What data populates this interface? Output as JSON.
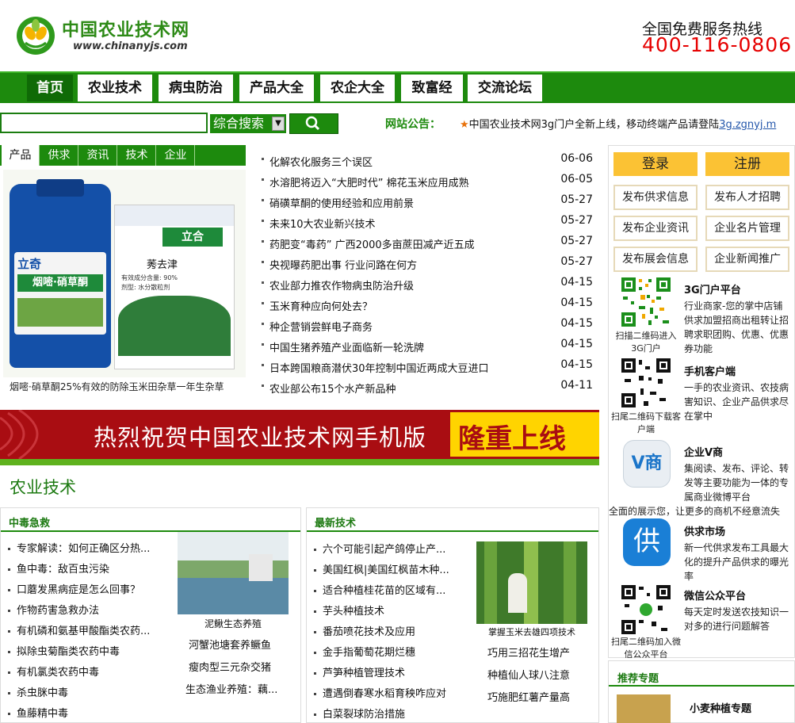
{
  "header": {
    "site_name": "中国农业技术网",
    "domain": "www.chinanyjs.com",
    "hotline_label": "全国免费服务热线",
    "hotline_number": "400-116-0806"
  },
  "nav": [
    "首页",
    "农业技术",
    "病虫防治",
    "产品大全",
    "农企大全",
    "致富经",
    "交流论坛"
  ],
  "search": {
    "placeholder": "",
    "select_value": "综合搜索"
  },
  "notice": {
    "label": "网站公告：",
    "text": "中国农业技术网3g门户全新上线，移动终端产品请登陆",
    "link": "3g.zgnyj.m"
  },
  "product_tabs": [
    "产品",
    "供求",
    "资讯",
    "技术",
    "企业"
  ],
  "product_showcase": {
    "caption": "烟嘧·硝草酮25%有效的防除玉米田杂草一年生杂草",
    "bottle_brand": "立奇",
    "bottle_product": "烟嘧·硝草酮",
    "bag_brand": "立合",
    "bag_product": "莠去津",
    "bag_detail": "有效成分含量: 90%",
    "bag_form": "剂型: 水分散粒剂"
  },
  "news": [
    {
      "title": "化解农化服务三个误区",
      "date": "06-06"
    },
    {
      "title": "水溶肥将迈入“大肥时代” 棉花玉米应用成熟",
      "date": "06-05"
    },
    {
      "title": "硝磺草酮的使用经验和应用前景",
      "date": "05-27"
    },
    {
      "title": "未来10大农业新兴技术",
      "date": "05-27"
    },
    {
      "title": "药肥变“毒药” 广西2000多亩蔗田减产近五成",
      "date": "05-27"
    },
    {
      "title": "央视曝药肥出事 行业问路在何方",
      "date": "05-27"
    },
    {
      "title": "农业部力推农作物病虫防治升级",
      "date": "04-15"
    },
    {
      "title": "玉米育种应向何处去？",
      "date": "04-15"
    },
    {
      "title": "种企营销尝鲜电子商务",
      "date": "04-15"
    },
    {
      "title": "中国生猪养殖产业面临新一轮洗牌",
      "date": "04-15"
    },
    {
      "title": "日本跨国粮商潜伏30年控制中国近两成大豆进口",
      "date": "04-15"
    },
    {
      "title": "农业部公布15个水产新品种",
      "date": "04-11"
    }
  ],
  "sidebar": {
    "login": "登录",
    "register": "注册",
    "actions": [
      "发布供求信息",
      "发布人才招聘",
      "发布企业资讯",
      "企业名片管理",
      "发布展会信息",
      "企业新闻推广"
    ],
    "platforms": [
      {
        "title": "3G门户平台",
        "desc": "行业商家-您的掌中店铺供求加盟招商出租转让招聘求职团购、优惠、优惠券功能",
        "caption": "扫描二维码进入3G门户"
      },
      {
        "title": "手机客户端",
        "desc": "一手的农业资讯、农技病害知识、企业产品供求尽在掌中",
        "caption": "扫尾二维码下载客户端"
      },
      {
        "title": "企业V商",
        "desc": "集阅读、发布、评论、转发等主要功能为一体的专属商业微博平台",
        "caption": "全面的展示您，让更多的商机不经意流失",
        "icon_letter": "V商"
      },
      {
        "title": "供求市场",
        "desc": "新一代供求发布工具最大化的提升产品供求的曝光率",
        "icon_letter": "供"
      },
      {
        "title": "微信公众平台",
        "desc": "每天定时发送农技知识一对多的进行问题解答",
        "caption": "扫尾二维码加入微信公众平台"
      }
    ]
  },
  "banner": {
    "text": "热烈祝贺中国农业技术网手机版",
    "highlight": "隆重上线"
  },
  "section_title": "农业技术",
  "panel_left": {
    "title": "中毒急救",
    "items": [
      "专家解读：如何正确区分热...",
      "鱼中毒：敌百虫污染",
      "口蘑发黑病症是怎么回事？",
      "作物药害急救办法",
      "有机磷和氨基甲酸酯类农药...",
      "拟除虫菊酯类农药中毒",
      "有机氯类农药中毒",
      "杀虫脒中毒",
      "鱼藤精中毒"
    ],
    "pic_caption": "泥鳅生态养殖",
    "right_items": [
      "河蟹池塘套养鳜鱼",
      "瘦肉型三元杂交猪",
      "生态渔业养殖：藕..."
    ]
  },
  "panel_right": {
    "title": "最新技术",
    "items": [
      "六个可能引起产鸽停止产...",
      "美国红枫|美国红枫苗木种...",
      "适合种植桂花苗的区域有...",
      "芋头种植技术",
      "番茄喷花技术及应用",
      "金手指葡萄花期烂穗",
      "芦笋种植管理技术",
      "遭遇倒春寒水稻育秧咋应对",
      "白菜裂球防治措施"
    ],
    "pic_caption": "掌握玉米去雄四项技术",
    "right_items": [
      "巧用三招花生增产",
      "种植仙人球八注意",
      "巧施肥红薯产量高"
    ]
  },
  "recommend": {
    "title": "推荐专题",
    "item": "小麦种植专题"
  },
  "colors": {
    "brand_green": "#1d8a0d",
    "hotline_red": "#e60000",
    "banner_red": "#a90d12",
    "accent_yellow": "#fbc234"
  }
}
